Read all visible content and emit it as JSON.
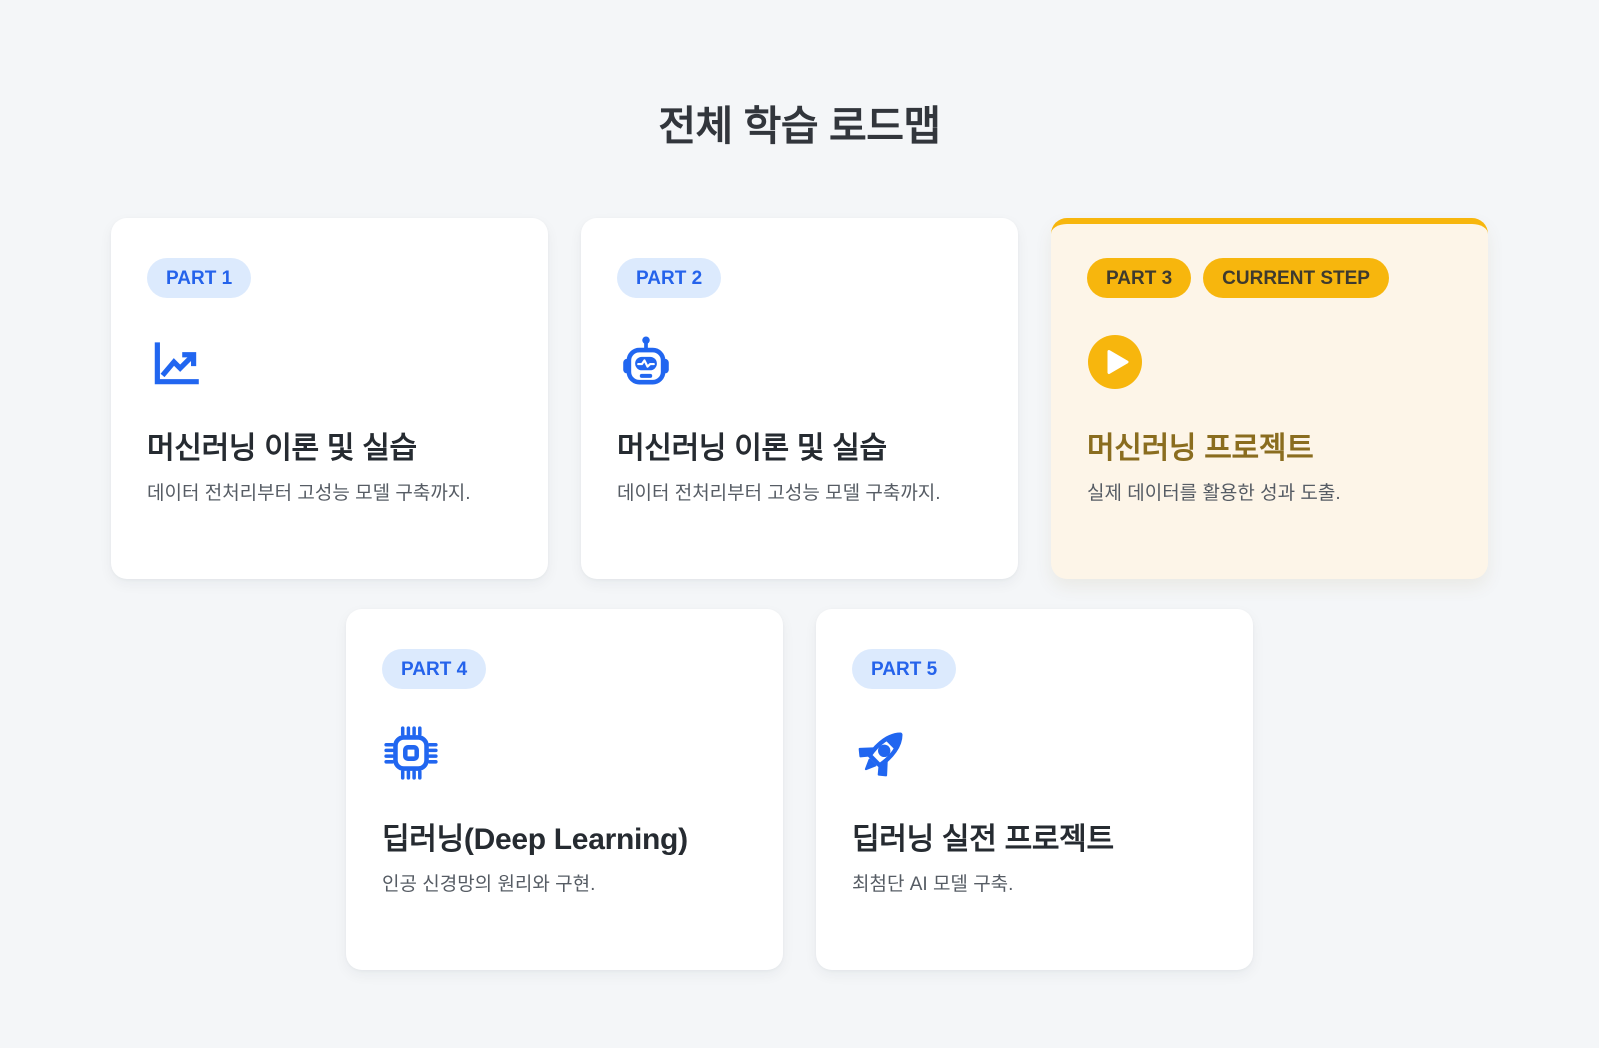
{
  "title": "전체 학습 로드맵",
  "colors": {
    "accent_blue": "#2166f0",
    "badge_blue_bg": "#dceafd",
    "badge_blue_text": "#2563eb",
    "current_yellow": "#f7b60d",
    "current_card_bg": "#fdf5e8",
    "current_title": "#8a6d1f",
    "page_bg": "#f4f6f8"
  },
  "cards": [
    {
      "part": "PART 1",
      "icon": "trending-chart-icon",
      "title": "머신러닝 이론 및 실습",
      "desc": "데이터 전처리부터 고성능 모델 구축까지."
    },
    {
      "part": "PART 2",
      "icon": "robot-icon",
      "title": "머신러닝 이론 및 실습",
      "desc": "데이터 전처리부터 고성능 모델 구축까지."
    },
    {
      "part": "PART 3",
      "current_label": "CURRENT STEP",
      "icon": "play-circle-icon",
      "title": "머신러닝 프로젝트",
      "desc": "실제 데이터를 활용한 성과 도출."
    },
    {
      "part": "PART 4",
      "icon": "chip-icon",
      "title": "딥러닝(Deep Learning)",
      "desc": "인공 신경망의 원리와 구현."
    },
    {
      "part": "PART 5",
      "icon": "rocket-icon",
      "title": "딥러닝 실전 프로젝트",
      "desc": "최첨단 AI 모델 구축."
    }
  ]
}
